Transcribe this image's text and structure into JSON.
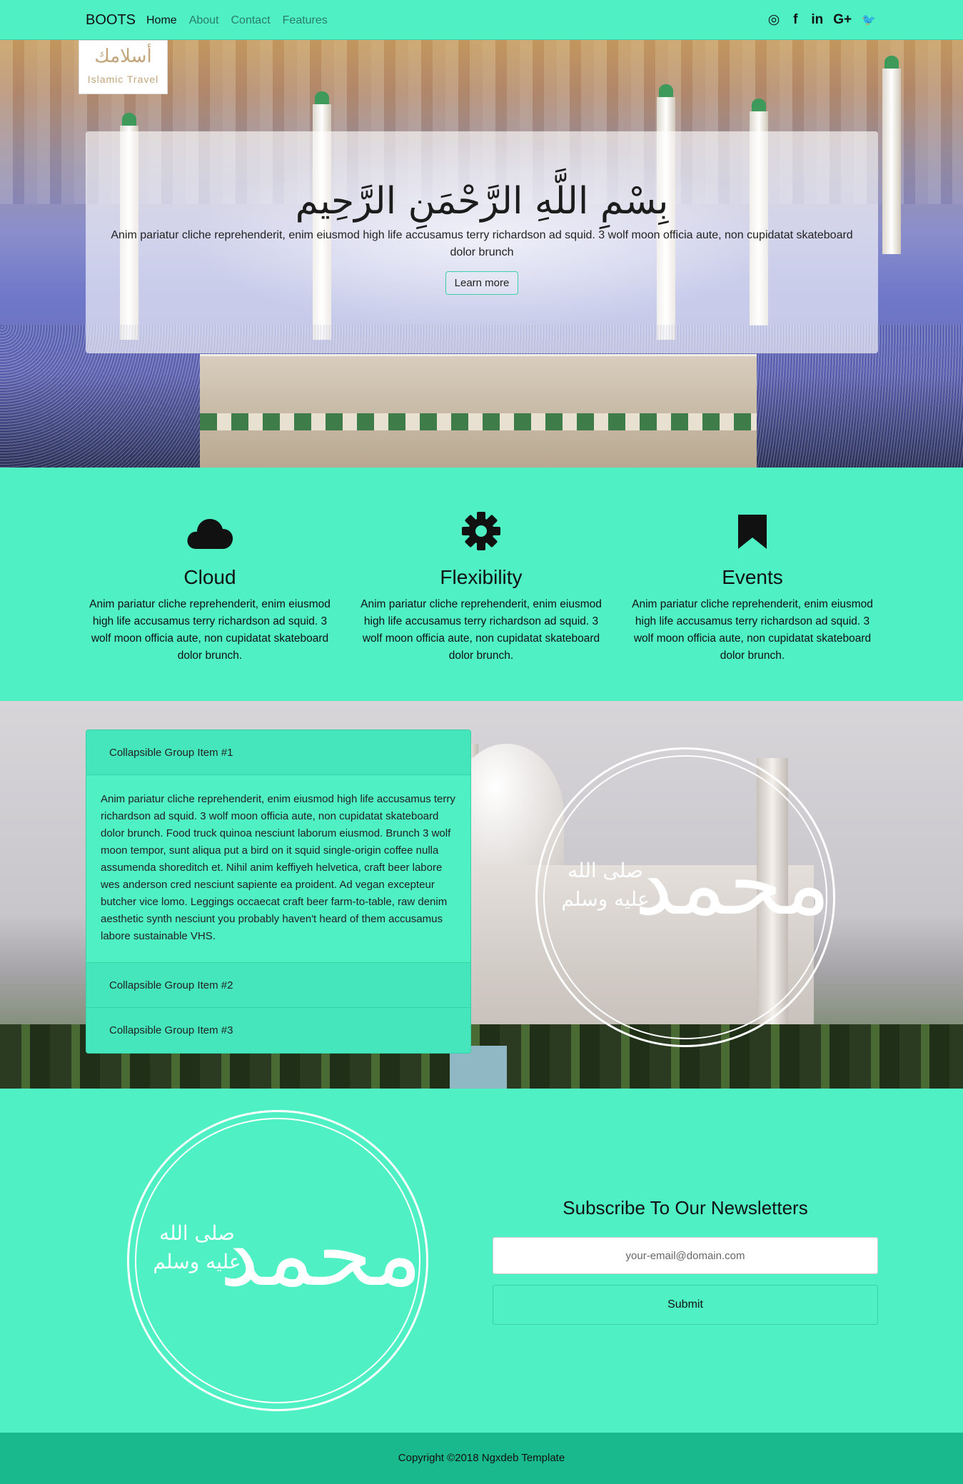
{
  "navbar": {
    "brand": "BOOTS",
    "links": [
      "Home",
      "About",
      "Contact",
      "Features"
    ],
    "active_link": "Home",
    "social_icons": [
      "github-icon",
      "facebook-icon",
      "linkedin-icon",
      "google-plus-icon",
      "twitter-icon"
    ],
    "social_glyphs": [
      "◎",
      "f",
      "in",
      "G+",
      "🐦"
    ]
  },
  "logo": {
    "arabic": "أسلامك",
    "english": "Islamic Travel"
  },
  "hero": {
    "title": "بِسْمِ اللَّهِ الرَّحْمَنِ الرَّحِيم",
    "lead": "Anim pariatur cliche reprehenderit, enim eiusmod high life accusamus terry richardson ad squid. 3 wolf moon officia aute, non cupidatat skateboard dolor brunch",
    "button": "Learn more"
  },
  "features": [
    {
      "icon": "cloud-icon",
      "title": "Cloud",
      "text": "Anim pariatur cliche reprehenderit, enim eiusmod high life accusamus terry richardson ad squid. 3 wolf moon officia aute, non cupidatat skateboard dolor brunch."
    },
    {
      "icon": "gear-icon",
      "title": "Flexibility",
      "text": "Anim pariatur cliche reprehenderit, enim eiusmod high life accusamus terry richardson ad squid. 3 wolf moon officia aute, non cupidatat skateboard dolor brunch."
    },
    {
      "icon": "bookmark-icon",
      "title": "Events",
      "text": "Anim pariatur cliche reprehenderit, enim eiusmod high life accusamus terry richardson ad squid. 3 wolf moon officia aute, non cupidatat skateboard dolor brunch."
    }
  ],
  "accordion": {
    "items": [
      {
        "title": "Collapsible Group Item #1",
        "expanded": true
      },
      {
        "title": "Collapsible Group Item #2",
        "expanded": false
      },
      {
        "title": "Collapsible Group Item #3",
        "expanded": false
      }
    ],
    "body": "Anim pariatur cliche reprehenderit, enim eiusmod high life accusamus terry richardson ad squid. 3 wolf moon officia aute, non cupidatat skateboard dolor brunch. Food truck quinoa nesciunt laborum eiusmod. Brunch 3 wolf moon tempor, sunt aliqua put a bird on it squid single-origin coffee nulla assumenda shoreditch et. Nihil anim keffiyeh helvetica, craft beer labore wes anderson cred nesciunt sapiente ea proident. Ad vegan excepteur butcher vice lomo. Leggings occaecat craft beer farm-to-table, raw denim aesthetic synth nesciunt you probably haven't heard of them accusamus labore sustainable VHS."
  },
  "calligraphy": {
    "name": "محمد",
    "salawat": "صلى الله عليه وسلم"
  },
  "newsletter": {
    "title": "Subscribe To Our Newsletters",
    "email_placeholder": "your-email@domain.com",
    "email_value": "",
    "submit": "Submit"
  },
  "footer": {
    "copyright": "Copyright ©2018 Ngxdeb Template"
  },
  "colors": {
    "primary": "#4ef0c4",
    "border": "#3ad0a8",
    "footer": "#1ab98d"
  }
}
